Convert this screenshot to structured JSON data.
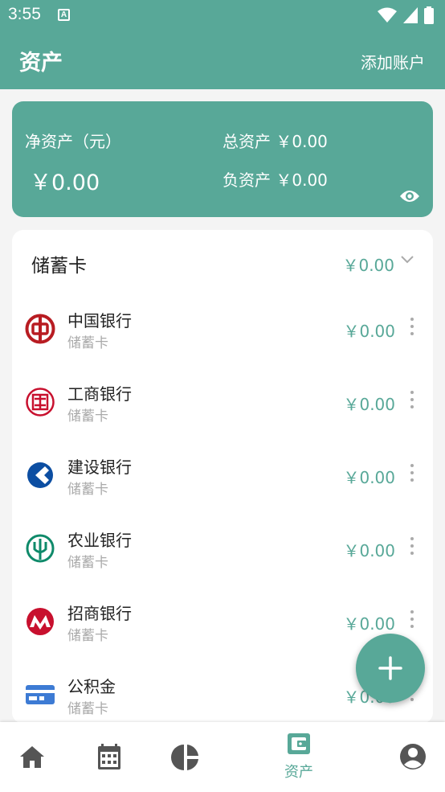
{
  "status_bar": {
    "time": "3:55",
    "notification_icon": "A"
  },
  "app_bar": {
    "title": "资产",
    "action": "添加账户"
  },
  "summary": {
    "net_label": "净资产（元）",
    "net_value": "￥0.00",
    "total_label": "总资产",
    "total_value": "￥0.00",
    "debt_label": "负资产",
    "debt_value": "￥0.00"
  },
  "group": {
    "title": "储蓄卡",
    "total": "￥0.00"
  },
  "accounts": [
    {
      "name": "中国银行",
      "type": "储蓄卡",
      "amount": "￥0.00",
      "logo": "boc-logo",
      "color": "#b81c22"
    },
    {
      "name": "工商银行",
      "type": "储蓄卡",
      "amount": "￥0.00",
      "logo": "icbc-logo",
      "color": "#c8102e"
    },
    {
      "name": "建设银行",
      "type": "储蓄卡",
      "amount": "￥0.00",
      "logo": "ccb-logo",
      "color": "#0c4ea2"
    },
    {
      "name": "农业银行",
      "type": "储蓄卡",
      "amount": "￥0.00",
      "logo": "abc-logo",
      "color": "#0f8a6a"
    },
    {
      "name": "招商银行",
      "type": "储蓄卡",
      "amount": "￥0.00",
      "logo": "cmb-logo",
      "color": "#c8102e"
    },
    {
      "name": "公积金",
      "type": "储蓄卡",
      "amount": "￥0.00",
      "logo": "card-logo",
      "color": "#3d7bd4"
    }
  ],
  "bottom_nav": {
    "assets_label": "资产"
  },
  "colors": {
    "accent": "#58a898",
    "icon_gray": "#555555",
    "muted": "#aaaaaa"
  }
}
